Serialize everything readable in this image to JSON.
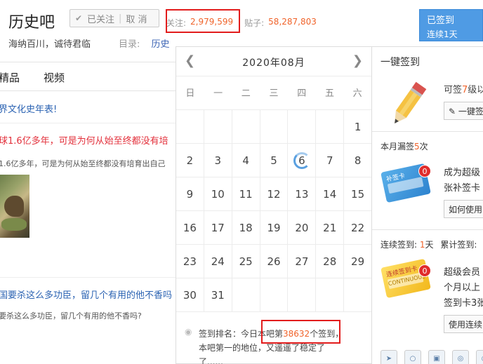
{
  "header": {
    "forum_name": "历史吧",
    "follow_status": "已关注",
    "cancel_label": "取 消",
    "follow_label": "关注:",
    "follow_count": "2,979,599",
    "posts_label": "贴子:",
    "posts_count": "58,287,803",
    "slogan": "海纳百川，诚待君临",
    "catalog_label": "目录:",
    "catalog_value": "历史"
  },
  "signin_button": {
    "status": "已签到",
    "streak": "连续1天"
  },
  "nav": {
    "tabs": [
      "精品",
      "视频"
    ]
  },
  "threads": [
    {
      "title": "界文化史年表!"
    },
    {
      "title": "球1.6亿多年，可是为何从始至终都没有培",
      "excerpt": "1.6亿多年，可是为何从始至终都没有培育出自己"
    },
    {
      "title": "国要杀这么多功臣，留几个有用的他不香吗",
      "excerpt": "要杀这么多功臣，留几个有用的他不香吗?"
    }
  ],
  "calendar": {
    "month_label": "2020年08月",
    "prev_icon": "chevron-left-icon",
    "next_icon": "chevron-right-icon",
    "weekdays": [
      "日",
      "一",
      "二",
      "三",
      "四",
      "五",
      "六"
    ],
    "weeks": [
      [
        "",
        "",
        "",
        "",
        "",
        "",
        "1"
      ],
      [
        "2",
        "3",
        "4",
        "5",
        "6",
        "7",
        "8"
      ],
      [
        "9",
        "10",
        "11",
        "12",
        "13",
        "14",
        "15"
      ],
      [
        "16",
        "17",
        "18",
        "19",
        "20",
        "21",
        "22"
      ],
      [
        "23",
        "24",
        "25",
        "26",
        "27",
        "28",
        "29"
      ],
      [
        "30",
        "31",
        "",
        "",
        "",
        "",
        ""
      ]
    ],
    "today": "6",
    "rank_prefix": "签到排名：今日本吧第",
    "rank_number": "38632",
    "rank_suffix": "个签到，",
    "rank_line2": "本吧第一的地位，又遥遥了稳定了",
    "rank_line3": "了......"
  },
  "right_panel": {
    "title": "一键签到",
    "can_sign_prefix": "可签",
    "can_sign_count": "7",
    "can_sign_suffix": "级以",
    "onekey_button": "一键签",
    "missed_prefix": "本月漏签",
    "missed_count": "5",
    "missed_suffix": "次",
    "makeup_card_label": "补签卡",
    "makeup_card_badge": "0",
    "makeup_text1": "成为超级",
    "makeup_text2": "张补签卡",
    "makeup_button": "如何使用",
    "streak_label": "连续签到:",
    "streak_days": "1",
    "streak_unit": "天",
    "total_label": "累计签到:",
    "streak_card_label": "连续签到卡",
    "streak_card_sub": "CONTINUOUS",
    "streak_card_badge": "0",
    "streak_text1": "超级会员",
    "streak_text2": "个月以上",
    "streak_text3": "签到卡3张",
    "streak_button": "使用连续",
    "bottom_icons": [
      "app-icon-1",
      "app-icon-2",
      "app-icon-3",
      "app-icon-4",
      "app-icon-5"
    ]
  },
  "colors": {
    "accent_orange": "#f0632a",
    "link_blue": "#2d64b3",
    "signin_blue": "#4f9be4",
    "highlight_red": "#e21c1c"
  }
}
